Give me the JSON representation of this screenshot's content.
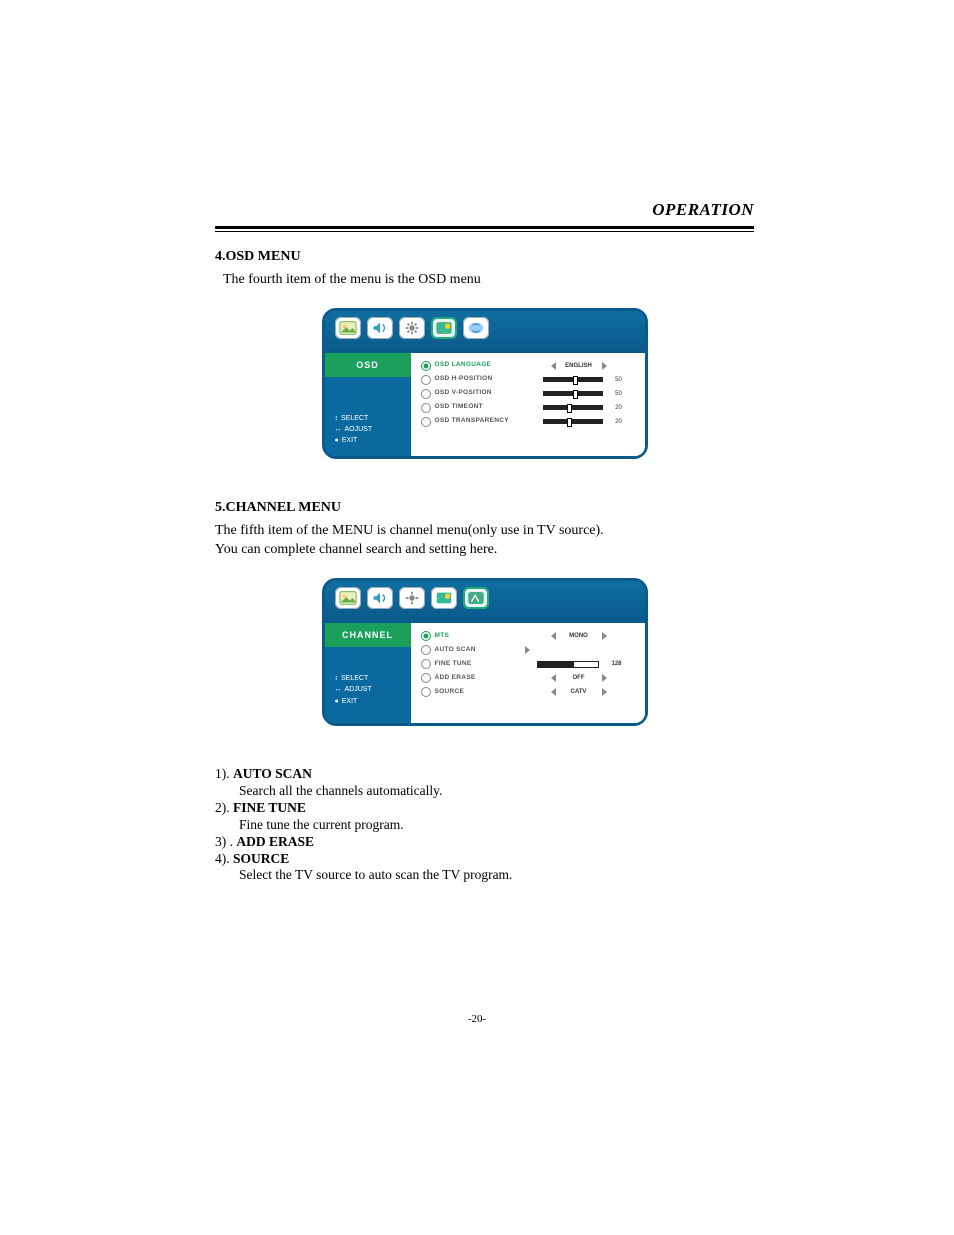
{
  "header": {
    "title": "OPERATION"
  },
  "section4": {
    "title": "4.OSD MENU",
    "desc": "The fourth item of the menu is the OSD menu",
    "panel": {
      "sideTitle": "OSD",
      "help": {
        "select": "SELECT",
        "adjust": "AOJUST",
        "exit": "EXIT"
      },
      "rows": [
        {
          "label": "OSD  LANGUAGE",
          "selected": true,
          "type": "choice",
          "value": "ENGLISH"
        },
        {
          "label": "OSD  H-POSITION",
          "selected": false,
          "type": "slider",
          "value": 50,
          "pct": 50
        },
        {
          "label": "OSD  V-POSITION",
          "selected": false,
          "type": "slider",
          "value": 50,
          "pct": 50
        },
        {
          "label": "OSD  TIMEONT",
          "selected": false,
          "type": "slider",
          "value": 20,
          "pct": 40
        },
        {
          "label": "OSD  TRANSPARENCY",
          "selected": false,
          "type": "slider",
          "value": 20,
          "pct": 40
        }
      ]
    }
  },
  "section5": {
    "title": "5.CHANNEL MENU",
    "desc1": "The fifth item of the MENU is channel menu(only use in TV source).",
    "desc2": "You can complete channel search and setting here.",
    "panel": {
      "sideTitle": "CHANNEL",
      "help": {
        "select": "SELECT",
        "adjust": "ADJUST",
        "exit": "EXIT"
      },
      "rows": [
        {
          "label": "MTS",
          "selected": true,
          "type": "choice",
          "value": "MONO"
        },
        {
          "label": "AUTO SCAN",
          "selected": false,
          "type": "go"
        },
        {
          "label": "FINE TUNE",
          "selected": false,
          "type": "progress",
          "value": 128,
          "pct": 60
        },
        {
          "label": "ADD ERASE",
          "selected": false,
          "type": "choice",
          "value": "OFF"
        },
        {
          "label": "SOURCE",
          "selected": false,
          "type": "choice",
          "value": "CATV"
        }
      ]
    },
    "explain": [
      {
        "num": "1).",
        "head": "AUTO  SCAN",
        "body": "Search all the channels automatically."
      },
      {
        "num": "2).",
        "head": "FINE TUNE",
        "body": "Fine tune the current program."
      },
      {
        "num": "3) .",
        "head": "ADD ERASE",
        "body": ""
      },
      {
        "num": "4).",
        "head": "SOURCE",
        "body": "Select the TV source to auto scan the TV program."
      }
    ]
  },
  "pageNumber": "-20-",
  "icons": [
    "picture",
    "audio",
    "settings",
    "osd",
    "channel"
  ]
}
